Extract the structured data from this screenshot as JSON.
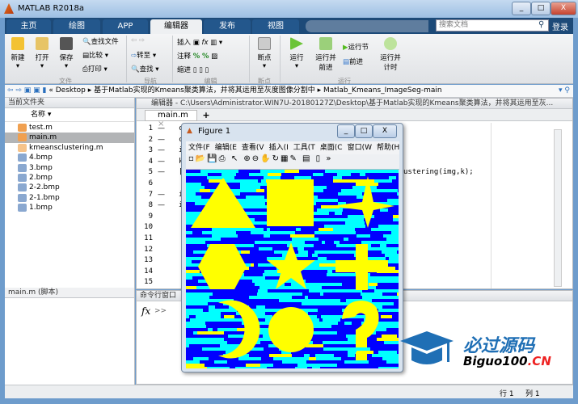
{
  "window": {
    "title": "MATLAB R2018a",
    "controls": [
      "minimize",
      "maximize",
      "close"
    ]
  },
  "tabs": [
    {
      "label": "主页"
    },
    {
      "label": "绘图"
    },
    {
      "label": "APP"
    },
    {
      "label": "编辑器",
      "active": true
    },
    {
      "label": "发布"
    },
    {
      "label": "视图"
    }
  ],
  "search": {
    "placeholder": "搜索文档"
  },
  "login": "登录",
  "ribbon": {
    "file": {
      "label": "文件",
      "new": "新建",
      "open": "打开",
      "save": "保存",
      "find_files": "查找文件",
      "compare": "比较",
      "print": "打印"
    },
    "nav": {
      "label": "导航",
      "goto": "转至",
      "find": "查找"
    },
    "edit": {
      "label": "编辑",
      "insert": "插入",
      "comment": "注释",
      "indent": "缩进",
      "fx": "fx"
    },
    "breakpoints": {
      "label": "断点",
      "breakpoint": "断点"
    },
    "run": {
      "label": "运行",
      "run": "运行",
      "run_advance": "运行并\n前进",
      "run_section": "运行节",
      "advance": "前进",
      "run_time": "运行并\n计时"
    }
  },
  "address": {
    "path": [
      "Desktop",
      "基于Matlab实现的Kmeans聚类算法，并将其运用至灰度图像分割中",
      "Matlab_Kmeans_ImageSeg-main"
    ]
  },
  "current_folder": {
    "title": "当前文件夹",
    "column": "名称",
    "files": [
      {
        "name": "test.m",
        "type": "script"
      },
      {
        "name": "main.m",
        "type": "script",
        "selected": true
      },
      {
        "name": "kmeansclustering.m",
        "type": "function"
      },
      {
        "name": "4.bmp",
        "type": "image"
      },
      {
        "name": "3.bmp",
        "type": "image"
      },
      {
        "name": "2.bmp",
        "type": "image"
      },
      {
        "name": "2-2.bmp",
        "type": "image"
      },
      {
        "name": "2-1.bmp",
        "type": "image"
      },
      {
        "name": "1.bmp",
        "type": "image"
      }
    ],
    "details": "main.m  (脚本)"
  },
  "editor": {
    "title": "编辑器 - C:\\Users\\Administrator.WIN7U-20180127Z\\Desktop\\基于Matlab实现的Kmeans聚类算法，并将其运用至灰...",
    "tab": "main.m",
    "add_tab": "+",
    "lines": [
      {
        "n": "1",
        "dash": "—",
        "code": "c"
      },
      {
        "n": "2",
        "dash": "—",
        "code": "c"
      },
      {
        "n": "3",
        "dash": "—",
        "code": "i"
      },
      {
        "n": "4",
        "dash": "—",
        "code": "k"
      },
      {
        "n": "5",
        "dash": "—",
        "code": "[",
        "tail": "ustering(img,k);"
      },
      {
        "n": "6",
        "dash": "",
        "code": ""
      },
      {
        "n": "7",
        "dash": "—",
        "code": "i"
      },
      {
        "n": "8",
        "dash": "—",
        "code": "i"
      },
      {
        "n": "9"
      },
      {
        "n": "10"
      },
      {
        "n": "11"
      },
      {
        "n": "12"
      },
      {
        "n": "13"
      },
      {
        "n": "14"
      },
      {
        "n": "15"
      }
    ]
  },
  "command_window": {
    "title": "命令行窗口",
    "prompt": ">>",
    "fx": "fx"
  },
  "status": {
    "row_label": "行",
    "row": "1",
    "col_label": "列",
    "col": "1"
  },
  "figure": {
    "title": "Figure 1",
    "menu": [
      "文件(F",
      "编辑(E",
      "查看(V",
      "插入(I",
      "工具(T",
      "桌面(C",
      "窗口(W",
      "帮助(H"
    ],
    "colors": {
      "background": "#0000ff",
      "band": "#00ffff",
      "shape": "#ffff00"
    },
    "shapes": [
      "triangle",
      "square",
      "star-4",
      "hexagon",
      "star-5",
      "cross",
      "crescent",
      "circle",
      "question-mark"
    ]
  },
  "watermark": {
    "cn": "必过源码",
    "en": "Biguo100",
    ".cn": ".CN"
  }
}
